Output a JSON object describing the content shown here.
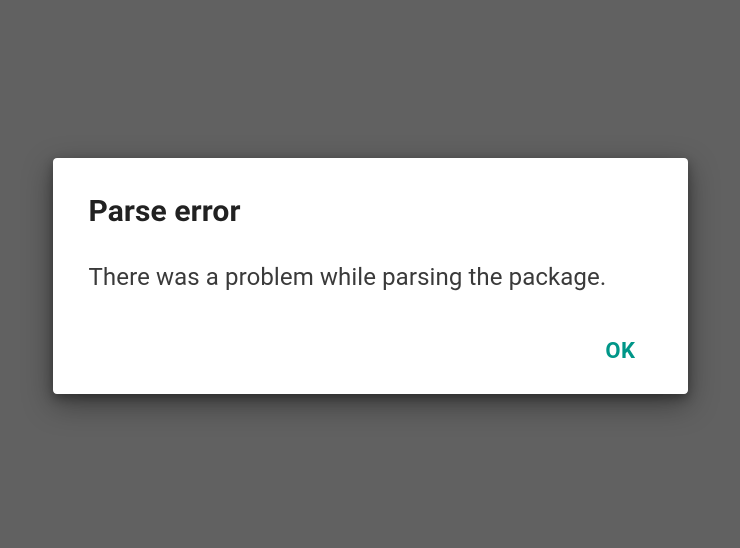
{
  "dialog": {
    "title": "Parse error",
    "message": "There was a problem while parsing the package.",
    "ok_label": "OK"
  }
}
